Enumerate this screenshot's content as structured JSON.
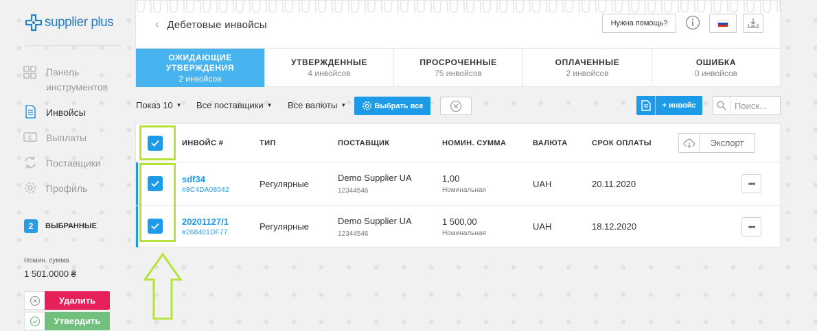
{
  "brand": {
    "name": "supplier plus"
  },
  "sidebar": {
    "items": [
      {
        "label": "Панель инструментов",
        "icon": "dashboard-icon",
        "active": false
      },
      {
        "label": "Инвойсы",
        "icon": "document-icon",
        "active": true
      },
      {
        "label": "Выплаты",
        "icon": "payout-icon",
        "active": false
      },
      {
        "label": "Поставщики",
        "icon": "suppliers-icon",
        "active": false
      },
      {
        "label": "Профиль",
        "icon": "gear-icon",
        "active": false
      }
    ],
    "selected": {
      "count": "2",
      "label": "ВЫБРАННЫЕ"
    },
    "nominal": {
      "label": "Номин. сумма",
      "value": "1 501.0000 ₴"
    },
    "actions": {
      "delete_label": "Удалить",
      "approve_label": "Утвердить"
    }
  },
  "header": {
    "back_icon": "chevron-left-icon",
    "title": "Дебетовые инвойсы",
    "help_label": "Нужна помощь?",
    "language_flag": "ru-flag",
    "tabs": [
      {
        "title": "ОЖИДАЮЩИЕ УТВЕРЖДЕНИЯ",
        "subtitle": "2 инвойсов",
        "active": true
      },
      {
        "title": "УТВЕРЖДЕННЫЕ",
        "subtitle": "4 инвойсов",
        "active": false
      },
      {
        "title": "ПРОСРОЧЕННЫЕ",
        "subtitle": "75 инвойсов",
        "active": false
      },
      {
        "title": "ОПЛАЧЕННЫЕ",
        "subtitle": "2 инвойсов",
        "active": false
      },
      {
        "title": "ОШИБКА",
        "subtitle": "0 инвойсов",
        "active": false
      }
    ]
  },
  "toolbar": {
    "show_label": "Показ 10",
    "suppliers_filter": "Все поставщики",
    "currency_filter": "Все валюты",
    "select_all_label": "Выбрать все",
    "add_invoice_label": "+ инвойс",
    "search_placeholder": "Поиск..."
  },
  "table": {
    "columns": [
      "ИНВОЙС #",
      "ТИП",
      "ПОСТАВЩИК",
      "НОМИН. СУММА",
      "ВАЛЮТА",
      "СРОК ОПЛАТЫ"
    ],
    "export_label": "Экспорт",
    "rows": [
      {
        "invoice": "sdf34",
        "invoice_id": "#8C4DA08042",
        "type": "Регулярные",
        "supplier": "Demo Supplier UA",
        "supplier_code": "12344546",
        "amount": "1,00",
        "amount_note": "Номинальная",
        "currency": "UAH",
        "due_date": "20.11.2020",
        "checked": true
      },
      {
        "invoice": "20201127/1",
        "invoice_id": "#268401DF77",
        "type": "Регулярные",
        "supplier": "Demo Supplier UA",
        "supplier_code": "12344546",
        "amount": "1 500,00",
        "amount_note": "Номинальная",
        "currency": "UAH",
        "due_date": "18.12.2020",
        "checked": true
      }
    ],
    "header_checked": true
  },
  "colors": {
    "accent": "#1e9be8",
    "tab_active": "#47b3ef",
    "danger": "#e8205a",
    "success": "#72c07e",
    "highlight": "#b6e23a",
    "brand": "#2a7fc0"
  }
}
